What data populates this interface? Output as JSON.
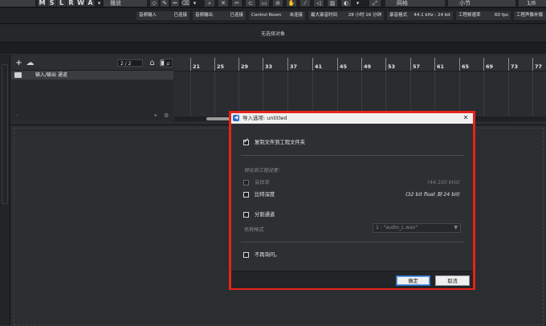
{
  "toolbar": {
    "mode_letters": [
      "M",
      "S",
      "L",
      "R",
      "W",
      "A"
    ],
    "tool_mode": "播放",
    "snap_mode": "网格",
    "quantize": "小节",
    "quantize_value": "1/8"
  },
  "statusbar": {
    "cells": [
      {
        "label": "音频输入",
        "value": "已连接"
      },
      {
        "label": "音频输出",
        "value": "已连接"
      },
      {
        "label": "Control Room",
        "value": "未连接"
      },
      {
        "label": "最大录音时间",
        "value": "28 小时 16 分钟"
      },
      {
        "label": "录音格式",
        "value": "44.1 kHz - 24 bit"
      },
      {
        "label": "工程帧速率",
        "value": "60 fps"
      },
      {
        "label": "工程声像补偿",
        "value": ""
      }
    ]
  },
  "infobar": {
    "text": "无选择对象"
  },
  "track_list": {
    "count": "2 / 2",
    "tracks": [
      {
        "name": "输入/输出 通道"
      }
    ]
  },
  "ruler": {
    "bars": [
      "21",
      "25",
      "29",
      "33",
      "37",
      "41",
      "45",
      "49",
      "53",
      "57",
      "61",
      "65",
      "69",
      "73",
      "77"
    ]
  },
  "dialog": {
    "title": "导入选项: untitled",
    "copy_files": {
      "label": "复制文件到工程文件夹",
      "checked": true
    },
    "section_label": "转化到工程设置：",
    "sample_rate": {
      "label": "采样率",
      "value": "(44.100 kHz)",
      "enabled": false
    },
    "bit_depth": {
      "label": "比特深度",
      "value": "(32 bit float 到 24 bit)",
      "checked": false
    },
    "split_channels": {
      "label": "分割通道",
      "checked": false
    },
    "naming": {
      "label": "名称格式",
      "value": "1 : \"audio_L.wav\""
    },
    "dont_ask": {
      "label": "不再询问。",
      "checked": false
    },
    "ok_label": "确定",
    "cancel_label": "取消"
  }
}
